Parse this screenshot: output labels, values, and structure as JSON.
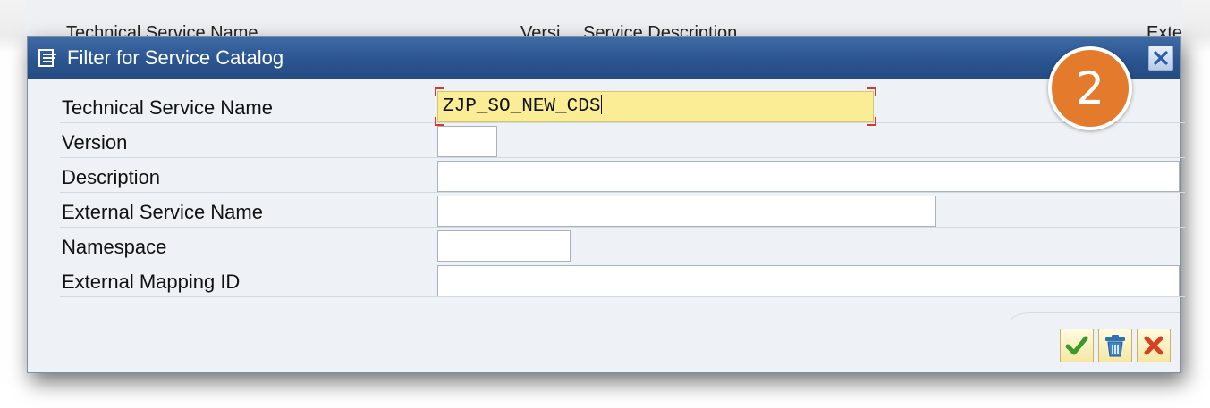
{
  "background": {
    "columns": [
      "Technical Service Name",
      "Versi",
      "Service Description",
      "Exte"
    ]
  },
  "dialog": {
    "title": "Filter for Service Catalog",
    "title_icon": "filter-icon",
    "close_icon": "close-icon"
  },
  "step_badge": "2",
  "fields": [
    {
      "label": "Technical Service Name",
      "value": "ZJP_SO_NEW_CDS",
      "focused": true
    },
    {
      "label": "Version",
      "value": ""
    },
    {
      "label": "Description",
      "value": ""
    },
    {
      "label": "External Service Name",
      "value": ""
    },
    {
      "label": "Namespace",
      "value": ""
    },
    {
      "label": "External Mapping ID",
      "value": ""
    }
  ],
  "footer_buttons": [
    {
      "name": "ok",
      "icon": "checkmark-icon",
      "color": "#3c9a2c"
    },
    {
      "name": "delete",
      "icon": "trash-icon",
      "color": "#2e72b8"
    },
    {
      "name": "cancel",
      "icon": "cross-icon",
      "color": "#d8401f"
    }
  ],
  "colors": {
    "titlebar": "#2b5591",
    "dialog_bg": "#eef1f5",
    "focused_field": "#fbec96",
    "badge": "#e47a2b"
  }
}
